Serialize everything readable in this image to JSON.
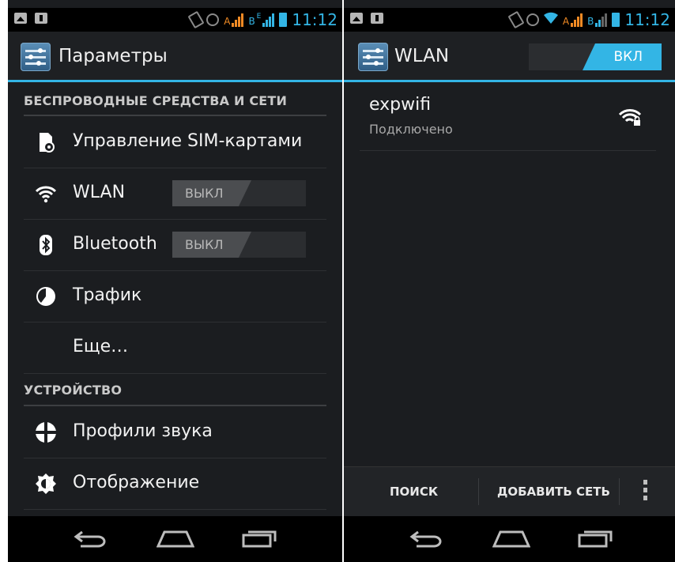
{
  "status_bar": {
    "time": "11:12",
    "sim1_label": "A",
    "sim2_label": "B",
    "sim2_type": "E"
  },
  "settings": {
    "title": "Параметры",
    "section_wireless": "БЕСПРОВОДНЫЕ СРЕДСТВА И СЕТИ",
    "items": [
      {
        "label": "Управление SIM-картами",
        "icon": "sim-card-icon"
      },
      {
        "label": "WLAN",
        "icon": "wifi-icon",
        "toggle": "ВЫКЛ"
      },
      {
        "label": "Bluetooth",
        "icon": "bluetooth-icon",
        "toggle": "ВЫКЛ"
      },
      {
        "label": "Трафик",
        "icon": "data-usage-icon"
      },
      {
        "label": "Еще…"
      }
    ],
    "section_device": "УСТРОЙСТВО",
    "device_items": [
      {
        "label": "Профили звука",
        "icon": "sound-profile-icon"
      },
      {
        "label": "Отображение",
        "icon": "display-icon"
      }
    ]
  },
  "wlan": {
    "title": "WLAN",
    "toggle": "ВКЛ",
    "network": {
      "name": "expwifi",
      "status": "Подключено"
    },
    "search_label": "ПОИСК",
    "add_network_label": "ДОБАВИТЬ СЕТЬ"
  },
  "colors": {
    "accent": "#33b5e5",
    "signal": "#f08a24",
    "background": "#1b1d20"
  }
}
